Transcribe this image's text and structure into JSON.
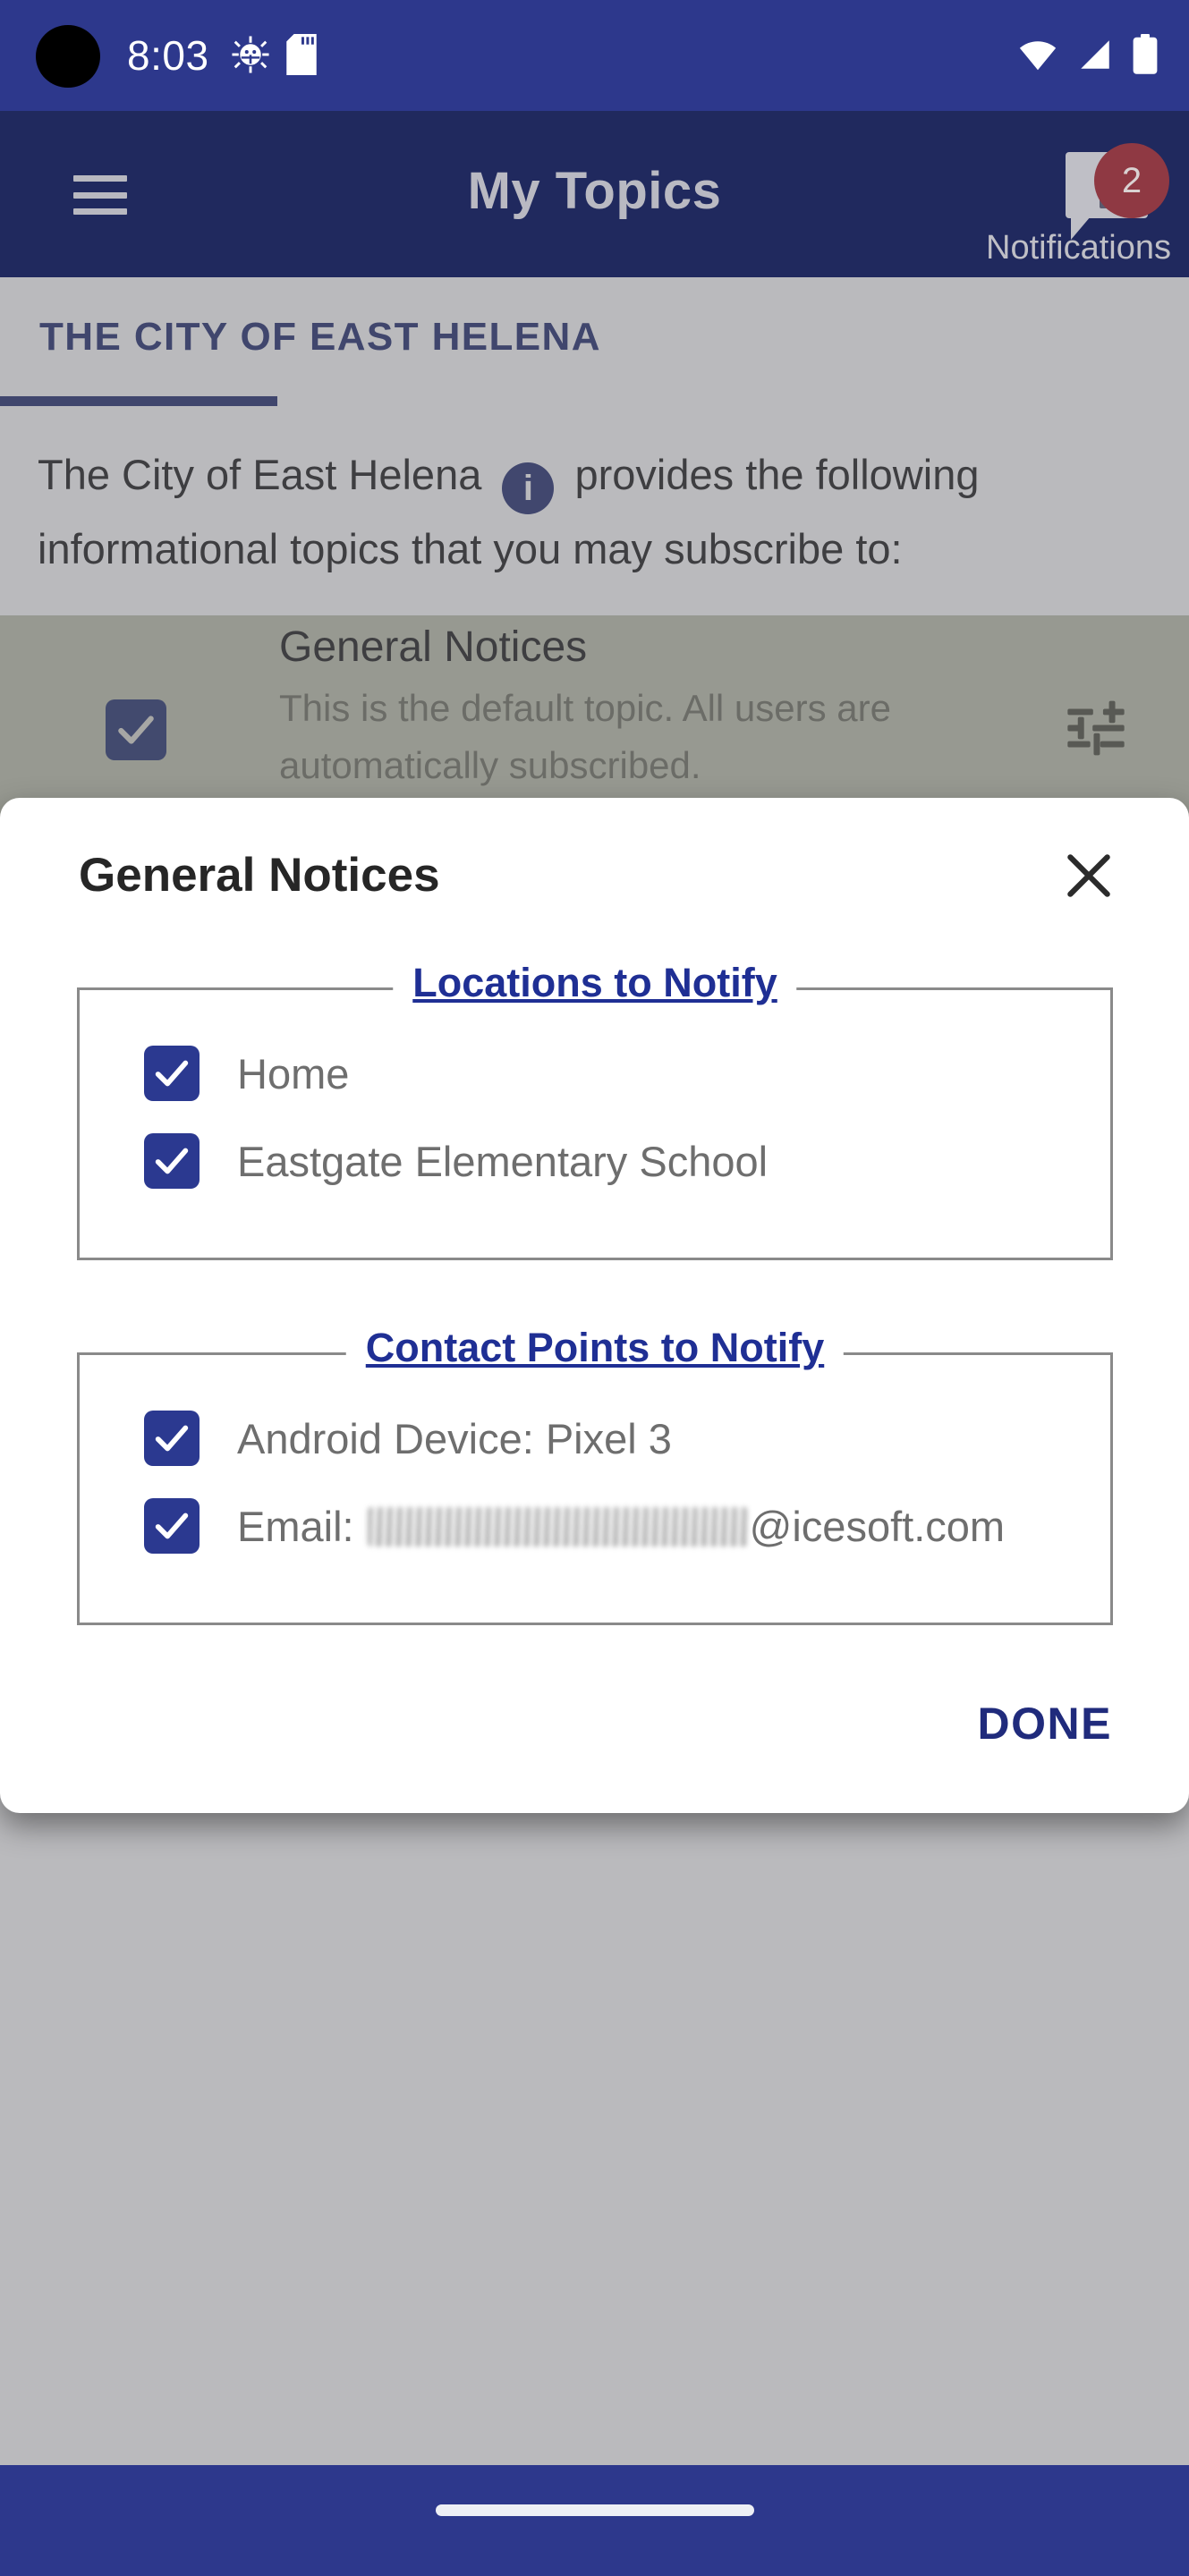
{
  "status_bar": {
    "time": "8:03",
    "icons_left": [
      "android-debug-icon",
      "sd-card-icon"
    ],
    "icons_right": [
      "wifi-icon",
      "cell-signal-icon",
      "battery-icon"
    ],
    "background_color": "#2D388C"
  },
  "app_bar": {
    "menu_icon": "hamburger-menu-icon",
    "title": "My Topics",
    "notifications_label": "Notifications",
    "notifications_count": "2",
    "badge_color": "#8F3943",
    "background_color": "#20295E"
  },
  "page": {
    "tab_label": "THE CITY OF EAST HELENA",
    "tab_accent_color": "#1E2A6B",
    "description_before": "The City of East Helena",
    "info_icon_glyph": "i",
    "description_after": "provides the following informational topics that you may subscribe to:",
    "topic": {
      "title": "General Notices",
      "subtitle": "This is the default topic. All users are automatically subscribed.",
      "checked": true,
      "settings_icon": "tune-sliders-icon",
      "row_background": "#BFC2AE"
    }
  },
  "dialog": {
    "title": "General Notices",
    "close_icon": "close-x-icon",
    "done_label": "DONE",
    "done_color": "#202B7C",
    "checkbox_color": "#2B3990",
    "sections": [
      {
        "legend": "Locations to Notify",
        "items": [
          {
            "label": "Home",
            "checked": true
          },
          {
            "label": "Eastgate Elementary School",
            "checked": true
          }
        ]
      },
      {
        "legend": "Contact Points to Notify",
        "items": [
          {
            "label": "Android Device: Pixel 3",
            "checked": true
          },
          {
            "label_prefix": "Email:",
            "label_redacted": true,
            "label_suffix": "@icesoft.com",
            "checked": true
          }
        ]
      }
    ]
  },
  "nav_bar": {
    "gesture_pill": "home-gesture-pill",
    "background_color": "#2D388C"
  }
}
